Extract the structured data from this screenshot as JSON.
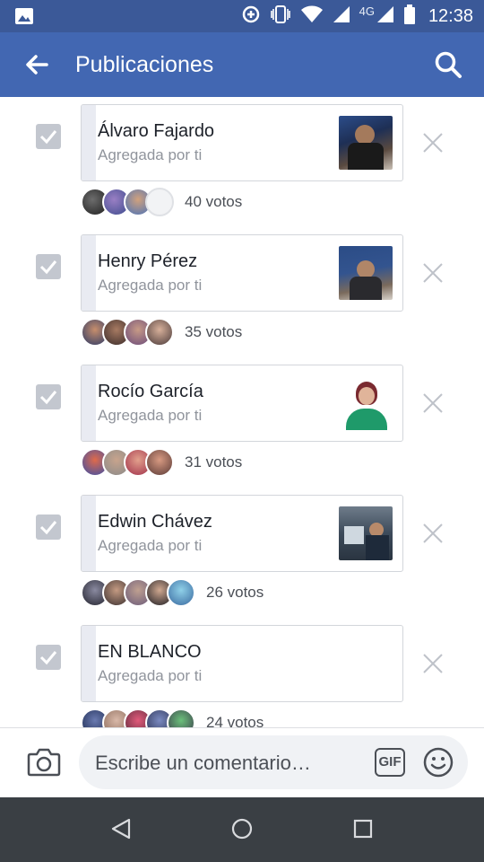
{
  "status_bar": {
    "time": "12:38",
    "network": "4G",
    "icons": [
      "image-icon",
      "data-saver-icon",
      "vibrate-icon",
      "wifi-icon",
      "signal-icon",
      "battery-icon"
    ]
  },
  "app_bar": {
    "title": "Publicaciones",
    "back_icon": "arrow-left-icon",
    "search_icon": "search-icon"
  },
  "options": [
    {
      "name": "Álvaro Fajardo",
      "added_by": "Agregada por ti",
      "votes_label": "40 votos",
      "checked": true,
      "thumb": "photo"
    },
    {
      "name": "Henry Pérez",
      "added_by": "Agregada por ti",
      "votes_label": "35 votos",
      "checked": true,
      "thumb": "photo"
    },
    {
      "name": "Rocío García",
      "added_by": "Agregada por ti",
      "votes_label": "31 votos",
      "checked": true,
      "thumb": "photo"
    },
    {
      "name": "Edwin Chávez",
      "added_by": "Agregada por ti",
      "votes_label": "26 votos",
      "checked": true,
      "thumb": "photo"
    },
    {
      "name": "EN BLANCO",
      "added_by": "Agregada por ti",
      "votes_label": "24 votos",
      "checked": true,
      "thumb": "none"
    }
  ],
  "composer": {
    "placeholder": "Escribe un comentario…",
    "gif_label": "GIF"
  },
  "colors": {
    "status_bar": "#3b5998",
    "app_bar": "#4267b2",
    "checkbox": "#c3c7cf",
    "nav_bar": "#3a3f44"
  }
}
